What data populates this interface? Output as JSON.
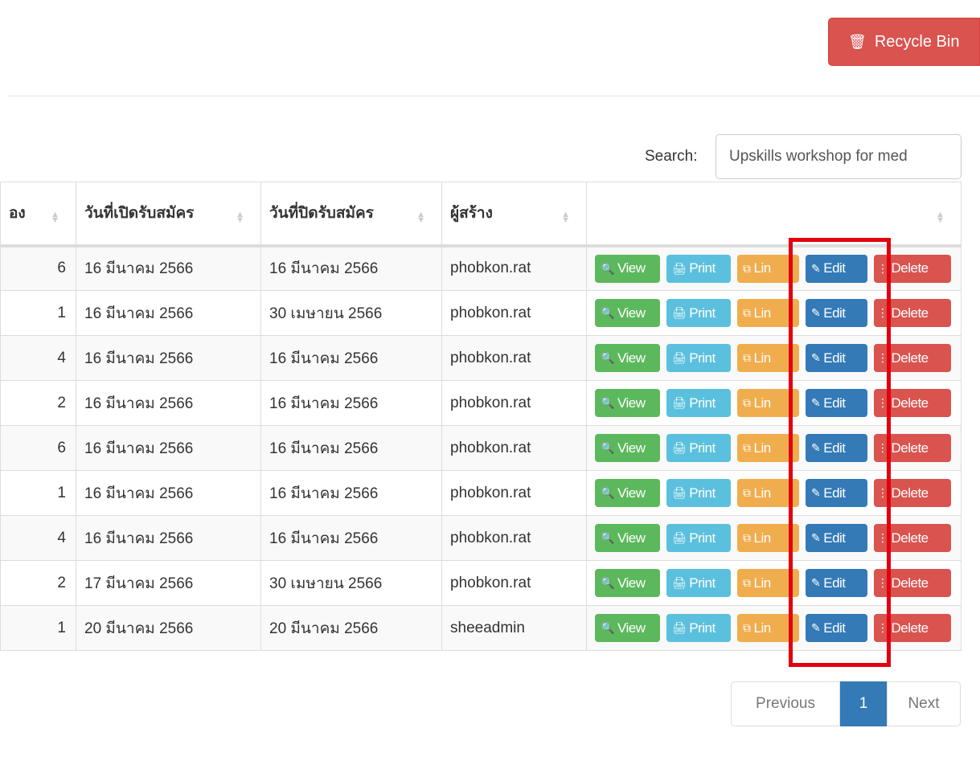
{
  "toolbar": {
    "recycle_bin_label": "Recycle Bin",
    "recycle_bin_icon": "trash-icon"
  },
  "search": {
    "label": "Search:",
    "value": "Upskills workshop for med"
  },
  "table": {
    "headers": [
      "อง",
      "วันที่เปิดรับสมัคร",
      "วันที่ปิดรับสมัคร",
      "ผู้สร้าง",
      ""
    ],
    "rows": [
      {
        "count": "6",
        "open_date": "16 มีนาคม 2566",
        "close_date": "16 มีนาคม 2566",
        "creator": "phobkon.rat"
      },
      {
        "count": "1",
        "open_date": "16 มีนาคม 2566",
        "close_date": "30 เมษายน 2566",
        "creator": "phobkon.rat"
      },
      {
        "count": "4",
        "open_date": "16 มีนาคม 2566",
        "close_date": "16 มีนาคม 2566",
        "creator": "phobkon.rat"
      },
      {
        "count": "2",
        "open_date": "16 มีนาคม 2566",
        "close_date": "16 มีนาคม 2566",
        "creator": "phobkon.rat"
      },
      {
        "count": "6",
        "open_date": "16 มีนาคม 2566",
        "close_date": "16 มีนาคม 2566",
        "creator": "phobkon.rat"
      },
      {
        "count": "1",
        "open_date": "16 มีนาคม 2566",
        "close_date": "16 มีนาคม 2566",
        "creator": "phobkon.rat"
      },
      {
        "count": "4",
        "open_date": "16 มีนาคม 2566",
        "close_date": "16 มีนาคม 2566",
        "creator": "phobkon.rat"
      },
      {
        "count": "2",
        "open_date": "17 มีนาคม 2566",
        "close_date": "30 เมษายน 2566",
        "creator": "phobkon.rat"
      },
      {
        "count": "1",
        "open_date": "20 มีนาคม 2566",
        "close_date": "20 มีนาคม 2566",
        "creator": "sheeadmin"
      }
    ],
    "actions": {
      "view": "View",
      "print": "Print",
      "link": "Lin",
      "edit": "Edit",
      "delete": "Delete"
    }
  },
  "pagination": {
    "previous": "Previous",
    "current": "1",
    "next": "Next"
  },
  "colors": {
    "danger": "#d9534f",
    "success": "#5cb85c",
    "info": "#5bc0de",
    "warning": "#f0ad4e",
    "primary": "#337ab7",
    "highlight_box": "#e3000f"
  }
}
